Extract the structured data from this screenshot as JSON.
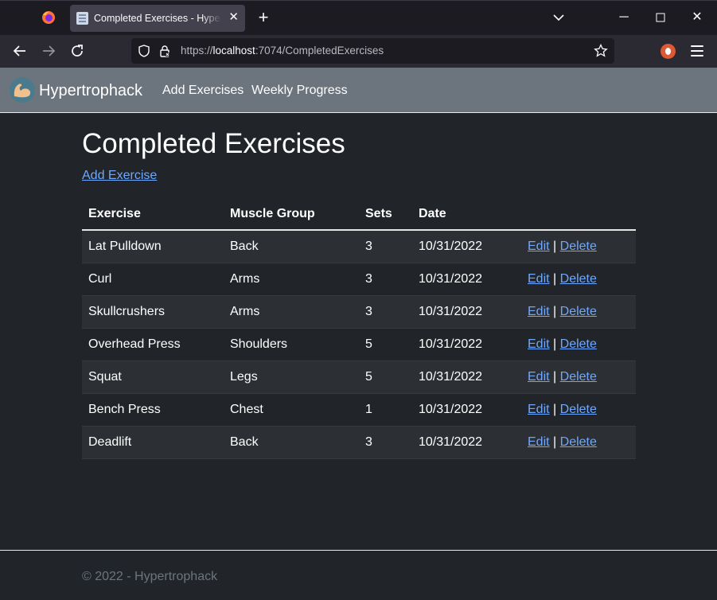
{
  "browser": {
    "tab_title": "Completed Exercises - Hypertrophack",
    "url_scheme": "https://",
    "url_host": "localhost",
    "url_path": ":7074/CompletedExercises",
    "icons": [
      "firefox-icon",
      "page-icon",
      "close-icon",
      "plus-icon",
      "chevron-down-icon",
      "minimize-icon",
      "maximize-icon",
      "close-window-icon",
      "back-arrow-icon",
      "forward-arrow-icon",
      "reload-icon",
      "shield-icon",
      "lock-icon",
      "star-icon",
      "duckduckgo-icon",
      "hamburger-menu-icon"
    ]
  },
  "app": {
    "brand": "Hypertrophack",
    "nav": [
      "Add Exercises",
      "Weekly Progress"
    ],
    "accent_color": "#6ea8fe",
    "navbar_color": "#6c757d"
  },
  "main": {
    "title": "Completed Exercises",
    "add_link": "Add Exercise",
    "columns": [
      "Exercise",
      "Muscle Group",
      "Sets",
      "Date"
    ],
    "edit_label": "Edit",
    "separator": "|",
    "delete_label": "Delete",
    "rows": [
      {
        "exercise": "Lat Pulldown",
        "muscle": "Back",
        "sets": "3",
        "date": "10/31/2022"
      },
      {
        "exercise": "Curl",
        "muscle": "Arms",
        "sets": "3",
        "date": "10/31/2022"
      },
      {
        "exercise": "Skullcrushers",
        "muscle": "Arms",
        "sets": "3",
        "date": "10/31/2022"
      },
      {
        "exercise": "Overhead Press",
        "muscle": "Shoulders",
        "sets": "5",
        "date": "10/31/2022"
      },
      {
        "exercise": "Squat",
        "muscle": "Legs",
        "sets": "5",
        "date": "10/31/2022"
      },
      {
        "exercise": "Bench Press",
        "muscle": "Chest",
        "sets": "1",
        "date": "10/31/2022"
      },
      {
        "exercise": "Deadlift",
        "muscle": "Back",
        "sets": "3",
        "date": "10/31/2022"
      }
    ]
  },
  "footer": {
    "text": "© 2022 - Hypertrophack"
  }
}
